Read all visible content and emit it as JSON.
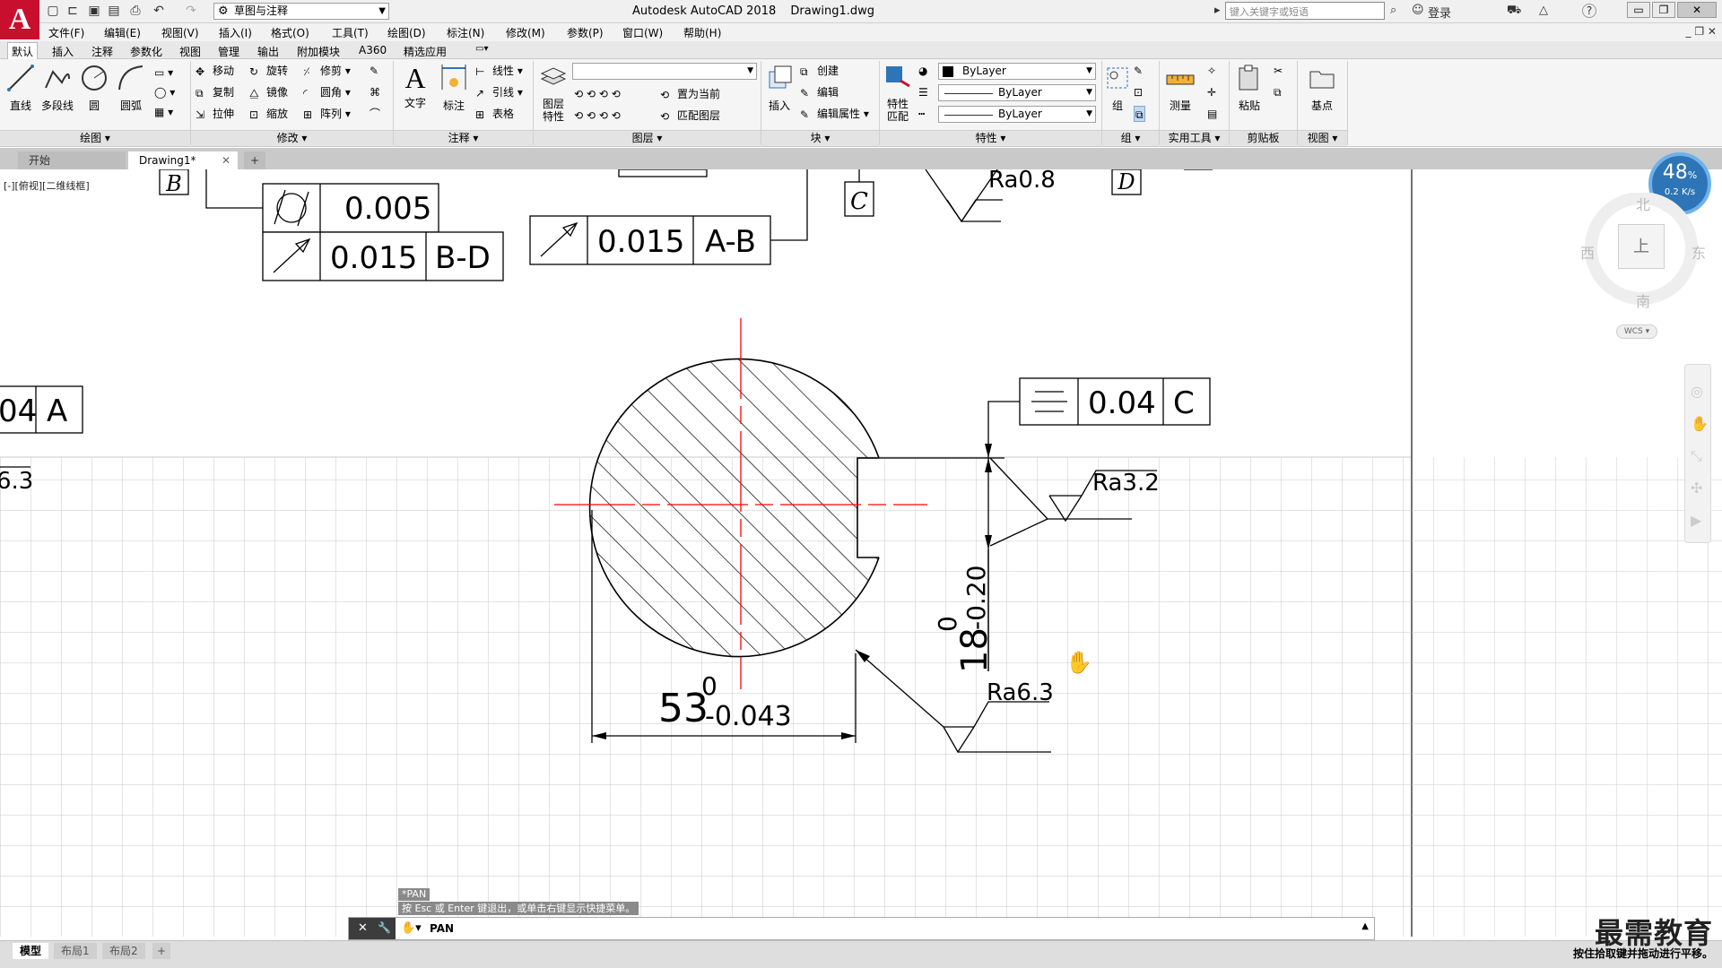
{
  "titlebar": {
    "app_logo": "A",
    "workspace": "草图与注释",
    "app_name": "Autodesk AutoCAD 2018",
    "file_name": "Drawing1.dwg",
    "search_placeholder": "键入关键字或短语",
    "signin": "登录",
    "help": "?"
  },
  "menu": [
    "文件(F)",
    "编辑(E)",
    "视图(V)",
    "插入(I)",
    "格式(O)",
    "工具(T)",
    "绘图(D)",
    "标注(N)",
    "修改(M)",
    "参数(P)",
    "窗口(W)",
    "帮助(H)"
  ],
  "ribbon_tabs": [
    "默认",
    "插入",
    "注释",
    "参数化",
    "视图",
    "管理",
    "输出",
    "附加模块",
    "A360",
    "精选应用"
  ],
  "ribbon": {
    "draw": {
      "title": "绘图",
      "line": "直线",
      "polyline": "多段线",
      "circle": "圆",
      "arc": "圆弧"
    },
    "modify": {
      "title": "修改",
      "move": "移动",
      "rotate": "旋转",
      "trim": "修剪",
      "copy": "复制",
      "mirror": "镜像",
      "fillet": "圆角",
      "stretch": "拉伸",
      "scale": "缩放",
      "array": "阵列"
    },
    "annotation": {
      "title": "注释",
      "text": "文字",
      "dimension": "标注",
      "linear": "线性",
      "leader": "引线",
      "table": "表格"
    },
    "layers": {
      "title": "图层",
      "props_l1": "图层",
      "props_l2": "特性",
      "set_current": "置为当前",
      "match_layer": "匹配图层"
    },
    "block": {
      "title": "块",
      "insert": "插入",
      "create": "创建",
      "edit": "编辑",
      "edit_attr": "编辑属性"
    },
    "properties": {
      "title": "特性",
      "match_l1": "特性",
      "match_l2": "匹配",
      "color": "ByLayer",
      "linetype": "ByLayer",
      "lineweight": "ByLayer"
    },
    "groups": {
      "title": "组",
      "group": "组"
    },
    "utilities": {
      "title": "实用工具",
      "measure": "测量"
    },
    "clipboard": {
      "title": "剪贴板",
      "paste": "粘贴"
    },
    "view": {
      "title": "视图",
      "base": "基点"
    }
  },
  "file_tabs": [
    "开始",
    "Drawing1*"
  ],
  "viewport": {
    "label": "[-][俯视][二维线框]",
    "viewcube": {
      "north": "北",
      "south": "南",
      "east": "东",
      "west": "西",
      "face": "上",
      "wcs": "WCS"
    },
    "net": {
      "percent": "48",
      "unit": "%",
      "speed": "0.2 K/s"
    }
  },
  "drawing": {
    "fcf1": {
      "tol": "0.005"
    },
    "fcf2": {
      "tol": "0.015",
      "datum": "B-D"
    },
    "fcf3": {
      "tol": "0.015",
      "datum": "A-B"
    },
    "fcf4": {
      "tol": "0.04",
      "datum": "C"
    },
    "fcf5": {
      "tol": "04",
      "datum": "A"
    },
    "datum_b": "B",
    "datum_c": "C",
    "datum_d": "D",
    "rough1": "Ra0.8",
    "rough2": "Ra3.2",
    "rough3": "Ra6.3",
    "rough_left": "6.3",
    "dim_dia_main": "53",
    "dim_dia_upper": "0",
    "dim_dia_lower": "-0.043",
    "dim_key_main": "18",
    "dim_key_upper": "0",
    "dim_key_lower": "-0.20"
  },
  "command": {
    "history1": "*PAN",
    "history2": "按 Esc 或 Enter 键退出，或单击右键显示快捷菜单。",
    "current": "PAN"
  },
  "layout_tabs": [
    "模型",
    "布局1",
    "布局2"
  ],
  "brand": {
    "name": "最需教育",
    "hint": "按住拾取键并拖动进行平移。"
  },
  "colors": {
    "logo": "#c8102e",
    "centerline": "#ff0000",
    "grid": "#c8c8c8",
    "accent": "#2d75b6"
  }
}
